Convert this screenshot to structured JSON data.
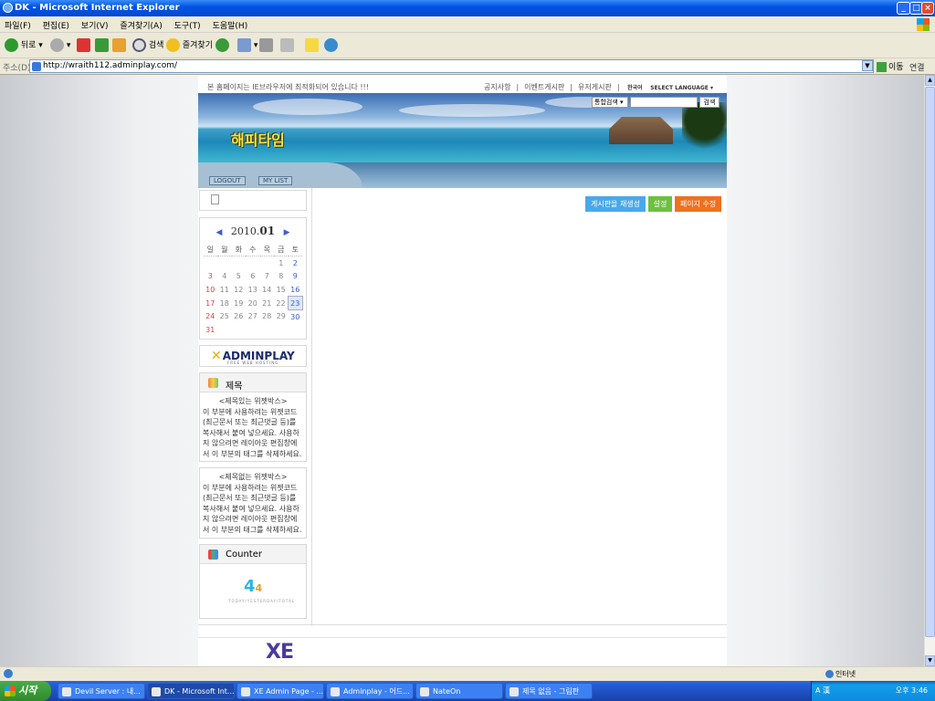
{
  "window": {
    "title": "DK - Microsoft Internet Explorer",
    "min": "_",
    "max": "□",
    "close": "×"
  },
  "menu": [
    "파일(F)",
    "편집(E)",
    "보기(V)",
    "즐겨찾기(A)",
    "도구(T)",
    "도움말(H)"
  ],
  "toolbar": {
    "back": "뒤로",
    "search": "검색",
    "favorites": "즐겨찾기"
  },
  "address": {
    "label": "주소(D)",
    "url": "http://wraith112.adminplay.com/",
    "go": "이동",
    "links": "연결"
  },
  "site": {
    "notice": "본 홈페이지는 IE브라우저에 최적화되어 있습니다 !!!",
    "nav": [
      "공지사항",
      "이벤트게시판",
      "유저게시판"
    ],
    "nav_sep": "|",
    "lang_ko": "한국어",
    "lang_select": "SELECT LANGUAGE ▾",
    "search_select": "통합검색 ▾",
    "search_button": "검색",
    "logo": "해피타임",
    "logout": "LOGOUT",
    "mylist": "MY LIST",
    "buttons": {
      "rebuild": "게시판을 재생성",
      "settings": "설정",
      "edit_page": "페이지 수정"
    },
    "colors": {
      "rebuild": "#4aa8e8",
      "settings": "#6ec040",
      "edit_page": "#f07020"
    }
  },
  "calendar": {
    "year": "2010.",
    "month": "01",
    "prev": "◀",
    "next": "▶",
    "dow": [
      "일",
      "월",
      "화",
      "수",
      "목",
      "금",
      "토"
    ],
    "weeks": [
      [
        "",
        "",
        "",
        "",
        "",
        "1",
        "2"
      ],
      [
        "3",
        "4",
        "5",
        "6",
        "7",
        "8",
        "9"
      ],
      [
        "10",
        "11",
        "12",
        "13",
        "14",
        "15",
        "16"
      ],
      [
        "17",
        "18",
        "19",
        "20",
        "21",
        "22",
        "23"
      ],
      [
        "24",
        "25",
        "26",
        "27",
        "28",
        "29",
        "30"
      ],
      [
        "31",
        "",
        "",
        "",
        "",
        "",
        ""
      ]
    ],
    "today": "23"
  },
  "adminplay": {
    "name": "ADMINPLAY",
    "sub": "FREE WEB HOSTING",
    "x": "✕"
  },
  "widget1": {
    "title": "제목",
    "heading": "<제목있는 위젯박스>",
    "body": "이 부분에 사용하려는 위젯코드(최근문서 또는 최근댓글 등)를 복사해서 붙여 넣으세요. 사용하지 않으려면 레이아웃 편집창에서 이 부분의 태그를 삭제하세요."
  },
  "widget2": {
    "heading": "<제목없는 위젯박스>",
    "body": "이 부분에 사용하려는 위젯코드(최근문서 또는 최근댓글 등)를 복사해서 붙여 넣으세요. 사용하지 않으려면 레이아웃 편집창에서 이 부분의 태그를 삭제하세요."
  },
  "counter": {
    "title": "Counter",
    "total": "4",
    "today": "4",
    "caption": "TODAY/YESTERDAY/TOTAL"
  },
  "footer": {
    "xe": "XE"
  },
  "statusbar": {
    "zone": "인터넷"
  },
  "taskbar": {
    "start": "시작",
    "tasks": [
      "Devil Server : 내...",
      "DK - Microsoft Int...",
      "XE Admin Page - ...",
      "Adminplay - 어드...",
      "NateOn",
      "제목 없음 - 그림판"
    ],
    "clock": "오후 3:46",
    "ime": "A 漢"
  }
}
